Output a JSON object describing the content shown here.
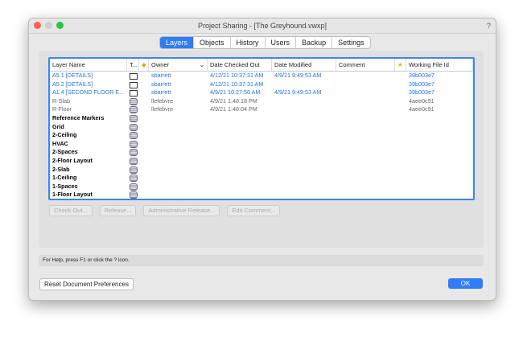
{
  "window": {
    "title": "Project Sharing - [The Greyhound.vwxp]",
    "help_icon": "?"
  },
  "tabs": [
    {
      "label": "Layers",
      "active": true
    },
    {
      "label": "Objects"
    },
    {
      "label": "History"
    },
    {
      "label": "Users"
    },
    {
      "label": "Backup"
    },
    {
      "label": "Settings"
    }
  ],
  "columns": {
    "layer_name": "Layer Name",
    "type": "T...",
    "owner": "Owner",
    "date_checked_out": "Date Checked Out",
    "date_modified": "Date Modified",
    "comment": "Comment",
    "working_file_id": "Working File Id"
  },
  "rows": [
    {
      "name": "A5.1 [DETAILS]",
      "type": "sheet",
      "owner": "sbarrett",
      "checked_out": "4/12/21  10:37:31 AM",
      "modified": "4/9/21  9:49:53 AM",
      "file_id": "39b003e7",
      "style": "blue"
    },
    {
      "name": "A5.2 [DETAILS]",
      "type": "sheet",
      "owner": "sbarrett",
      "checked_out": "4/12/21  10:37:31 AM",
      "modified": "",
      "file_id": "39b003e7",
      "style": "blue"
    },
    {
      "name": "A1.4 [SECOND FLOOR E...",
      "type": "sheet",
      "owner": "sbarrett",
      "checked_out": "4/9/21  10:27:56 AM",
      "modified": "4/9/21  9:49:53 AM",
      "file_id": "39b003e7",
      "style": "blue"
    },
    {
      "name": "R-Slab",
      "type": "layer",
      "owner": "llefebvre",
      "checked_out": "4/9/21  1:48:18 PM",
      "modified": "",
      "file_id": "4aee0c91",
      "style": "gray"
    },
    {
      "name": "R-Floor",
      "type": "layer",
      "owner": "llefebvre",
      "checked_out": "4/9/21  1:48:04 PM",
      "modified": "",
      "file_id": "4aee0c91",
      "style": "gray"
    },
    {
      "name": "Reference Markers",
      "type": "layer",
      "owner": "",
      "checked_out": "",
      "modified": "",
      "file_id": "",
      "style": "blk"
    },
    {
      "name": "Grid",
      "type": "layer",
      "owner": "",
      "checked_out": "",
      "modified": "",
      "file_id": "",
      "style": "blk"
    },
    {
      "name": "2-Ceiling",
      "type": "layer",
      "owner": "",
      "checked_out": "",
      "modified": "",
      "file_id": "",
      "style": "blk"
    },
    {
      "name": "HVAC",
      "type": "layer",
      "owner": "",
      "checked_out": "",
      "modified": "",
      "file_id": "",
      "style": "blk"
    },
    {
      "name": "2-Spaces",
      "type": "layer",
      "owner": "",
      "checked_out": "",
      "modified": "",
      "file_id": "",
      "style": "blk"
    },
    {
      "name": "2-Floor Layout",
      "type": "layer",
      "owner": "",
      "checked_out": "",
      "modified": "",
      "file_id": "",
      "style": "blk"
    },
    {
      "name": "2-Slab",
      "type": "layer",
      "owner": "",
      "checked_out": "",
      "modified": "",
      "file_id": "",
      "style": "blk"
    },
    {
      "name": "1-Ceiling",
      "type": "layer",
      "owner": "",
      "checked_out": "",
      "modified": "",
      "file_id": "",
      "style": "blk"
    },
    {
      "name": "1-Spaces",
      "type": "layer",
      "owner": "",
      "checked_out": "",
      "modified": "",
      "file_id": "",
      "style": "blk"
    },
    {
      "name": "1-Floor Layout",
      "type": "layer",
      "owner": "",
      "checked_out": "",
      "modified": "",
      "file_id": "",
      "style": "blk"
    }
  ],
  "actions": {
    "check_out": "Check Out...",
    "release": "Release...",
    "admin_release": "Administrative Release...",
    "edit_comment": "Edit Comment..."
  },
  "help_text": "For Help, press F1 or click the ? icon.",
  "footer": {
    "reset": "Reset Document Preferences",
    "ok": "OK"
  },
  "colors": {
    "accent": "#2f7cf6",
    "checked_out_text": "#1f74e8"
  }
}
